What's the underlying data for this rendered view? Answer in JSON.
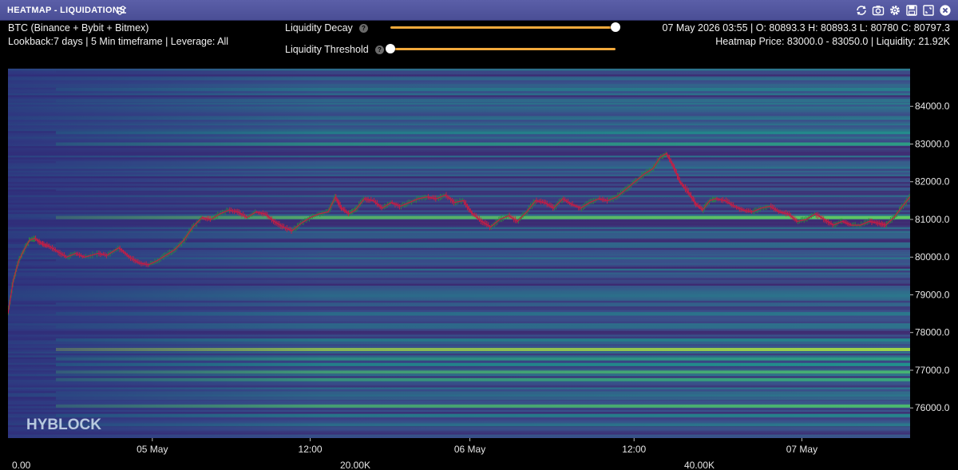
{
  "window": {
    "title": "HEATMAP - LIQUIDATIONS",
    "icons": [
      "tune-icon",
      "refresh-icon",
      "camera-icon",
      "gear-icon",
      "save-icon",
      "expand-icon",
      "close-icon"
    ]
  },
  "info": {
    "symbol": "BTC (Binance + Bybit + Bitmex)",
    "settings": "Lookback:7 days | 5 Min timeframe | Leverage: All",
    "ohlc": "07 May 2026 03:55 | O: 80893.3 H: 80893.3 L: 80780 C: 80797.3",
    "heatmap_info": "Heatmap Price: 83000.0 - 83050.0 | Liquidity: 21.92K"
  },
  "controls": {
    "decay_label": "Liquidity Decay",
    "threshold_label": "Liquidity Threshold",
    "decay_value": 1.0,
    "threshold_value": 0.0,
    "track_color": "#f2a93b"
  },
  "brand": {
    "logo_text": "HYBLOCK"
  },
  "chart_data": {
    "type": "heatmap",
    "title": "",
    "y_range": [
      75200,
      85000
    ],
    "y_ticks": [
      "84000.0",
      "83000.0",
      "82000.0",
      "81000.0",
      "80000.0",
      "79000.0",
      "78000.0",
      "77000.0",
      "76000.0"
    ],
    "y_tick_values": [
      84000,
      83000,
      82000,
      81000,
      80000,
      79000,
      78000,
      77000,
      76000
    ],
    "x_labels": [
      "05 May",
      "12:00",
      "06 May",
      "12:00",
      "07 May"
    ],
    "color_scale": {
      "min_label": "0.00",
      "mid_label": "20.00K",
      "max_label": "40.00K",
      "min": 0,
      "max": 40000
    },
    "colormap": [
      "#440154",
      "#3b528b",
      "#21918c",
      "#5ec962",
      "#fde725"
    ],
    "liquidity_levels": [
      {
        "price": 84900,
        "value": 9000
      },
      {
        "price": 84450,
        "value": 17000
      },
      {
        "price": 84150,
        "value": 15000
      },
      {
        "price": 83300,
        "value": 19000
      },
      {
        "price": 83000,
        "value": 21920
      },
      {
        "price": 82500,
        "value": 12000
      },
      {
        "price": 81800,
        "value": 11000
      },
      {
        "price": 81050,
        "value": 30000
      },
      {
        "price": 80350,
        "value": 14000
      },
      {
        "price": 80100,
        "value": 11000
      },
      {
        "price": 79900,
        "value": 10000
      },
      {
        "price": 79500,
        "value": 11000
      },
      {
        "price": 78750,
        "value": 13000
      },
      {
        "price": 78500,
        "value": 16000
      },
      {
        "price": 78150,
        "value": 15000
      },
      {
        "price": 77800,
        "value": 18000
      },
      {
        "price": 77550,
        "value": 34000
      },
      {
        "price": 77300,
        "value": 22000
      },
      {
        "price": 77150,
        "value": 20000
      },
      {
        "price": 76950,
        "value": 26000
      },
      {
        "price": 76750,
        "value": 24000
      },
      {
        "price": 76400,
        "value": 14000
      },
      {
        "price": 76250,
        "value": 13000
      },
      {
        "price": 76050,
        "value": 27000
      },
      {
        "price": 75800,
        "value": 18000
      },
      {
        "price": 75550,
        "value": 16000
      }
    ],
    "price_path": [
      [
        0,
        78500
      ],
      [
        0.6,
        79400
      ],
      [
        1.2,
        79900
      ],
      [
        1.8,
        80200
      ],
      [
        2.4,
        80450
      ],
      [
        3,
        80500
      ],
      [
        3.8,
        80350
      ],
      [
        4.5,
        80300
      ],
      [
        5.5,
        80150
      ],
      [
        6.5,
        80000
      ],
      [
        7.5,
        80100
      ],
      [
        8.5,
        80000
      ],
      [
        10,
        80100
      ],
      [
        11,
        80050
      ],
      [
        12.3,
        80250
      ],
      [
        13.5,
        80000
      ],
      [
        14.5,
        79850
      ],
      [
        15.6,
        79800
      ],
      [
        16.5,
        79900
      ],
      [
        17.5,
        80050
      ],
      [
        18.5,
        80200
      ],
      [
        19.5,
        80450
      ],
      [
        20.5,
        80800
      ],
      [
        21.5,
        81050
      ],
      [
        22.5,
        81000
      ],
      [
        23.5,
        81150
      ],
      [
        24.5,
        81250
      ],
      [
        25.5,
        81200
      ],
      [
        26.5,
        81050
      ],
      [
        27.5,
        81200
      ],
      [
        28.5,
        81150
      ],
      [
        29.5,
        80950
      ],
      [
        30.5,
        80800
      ],
      [
        31.5,
        80700
      ],
      [
        32.5,
        80900
      ],
      [
        33.5,
        81050
      ],
      [
        34.5,
        81150
      ],
      [
        35.5,
        81200
      ],
      [
        36.3,
        81600
      ],
      [
        37,
        81300
      ],
      [
        37.8,
        81150
      ],
      [
        38.5,
        81250
      ],
      [
        39.5,
        81550
      ],
      [
        40.5,
        81500
      ],
      [
        41.5,
        81300
      ],
      [
        42.5,
        81450
      ],
      [
        43.5,
        81350
      ],
      [
        44.5,
        81450
      ],
      [
        45.5,
        81550
      ],
      [
        46.5,
        81600
      ],
      [
        47.5,
        81550
      ],
      [
        48.5,
        81650
      ],
      [
        49.5,
        81450
      ],
      [
        50.5,
        81500
      ],
      [
        51.5,
        81150
      ],
      [
        52.5,
        80950
      ],
      [
        53.5,
        80800
      ],
      [
        54.5,
        81000
      ],
      [
        55.5,
        81100
      ],
      [
        56.5,
        80950
      ],
      [
        57.5,
        81200
      ],
      [
        58.5,
        81500
      ],
      [
        59.5,
        81450
      ],
      [
        60.5,
        81300
      ],
      [
        61.5,
        81550
      ],
      [
        62.5,
        81400
      ],
      [
        63.5,
        81300
      ],
      [
        64.5,
        81450
      ],
      [
        65.5,
        81550
      ],
      [
        66.5,
        81500
      ],
      [
        67.5,
        81600
      ],
      [
        68.5,
        81800
      ],
      [
        69.5,
        82000
      ],
      [
        70.5,
        82200
      ],
      [
        71.5,
        82350
      ],
      [
        72.3,
        82650
      ],
      [
        73,
        82750
      ],
      [
        73.8,
        82400
      ],
      [
        74.5,
        82000
      ],
      [
        75.5,
        81700
      ],
      [
        76.3,
        81400
      ],
      [
        77,
        81250
      ],
      [
        77.8,
        81500
      ],
      [
        78.5,
        81550
      ],
      [
        79.5,
        81500
      ],
      [
        80.5,
        81350
      ],
      [
        81.5,
        81250
      ],
      [
        82.5,
        81200
      ],
      [
        83.5,
        81300
      ],
      [
        84.5,
        81350
      ],
      [
        85.5,
        81200
      ],
      [
        86.5,
        81150
      ],
      [
        87.5,
        80950
      ],
      [
        88.5,
        81000
      ],
      [
        89.5,
        81150
      ],
      [
        90.5,
        81000
      ],
      [
        91.5,
        80850
      ],
      [
        92.5,
        80950
      ],
      [
        93.5,
        80850
      ],
      [
        94.5,
        80850
      ],
      [
        95.5,
        80950
      ],
      [
        96.5,
        80900
      ],
      [
        97.3,
        80850
      ],
      [
        98.2,
        81050
      ],
      [
        99,
        81300
      ],
      [
        100,
        81600
      ]
    ]
  }
}
